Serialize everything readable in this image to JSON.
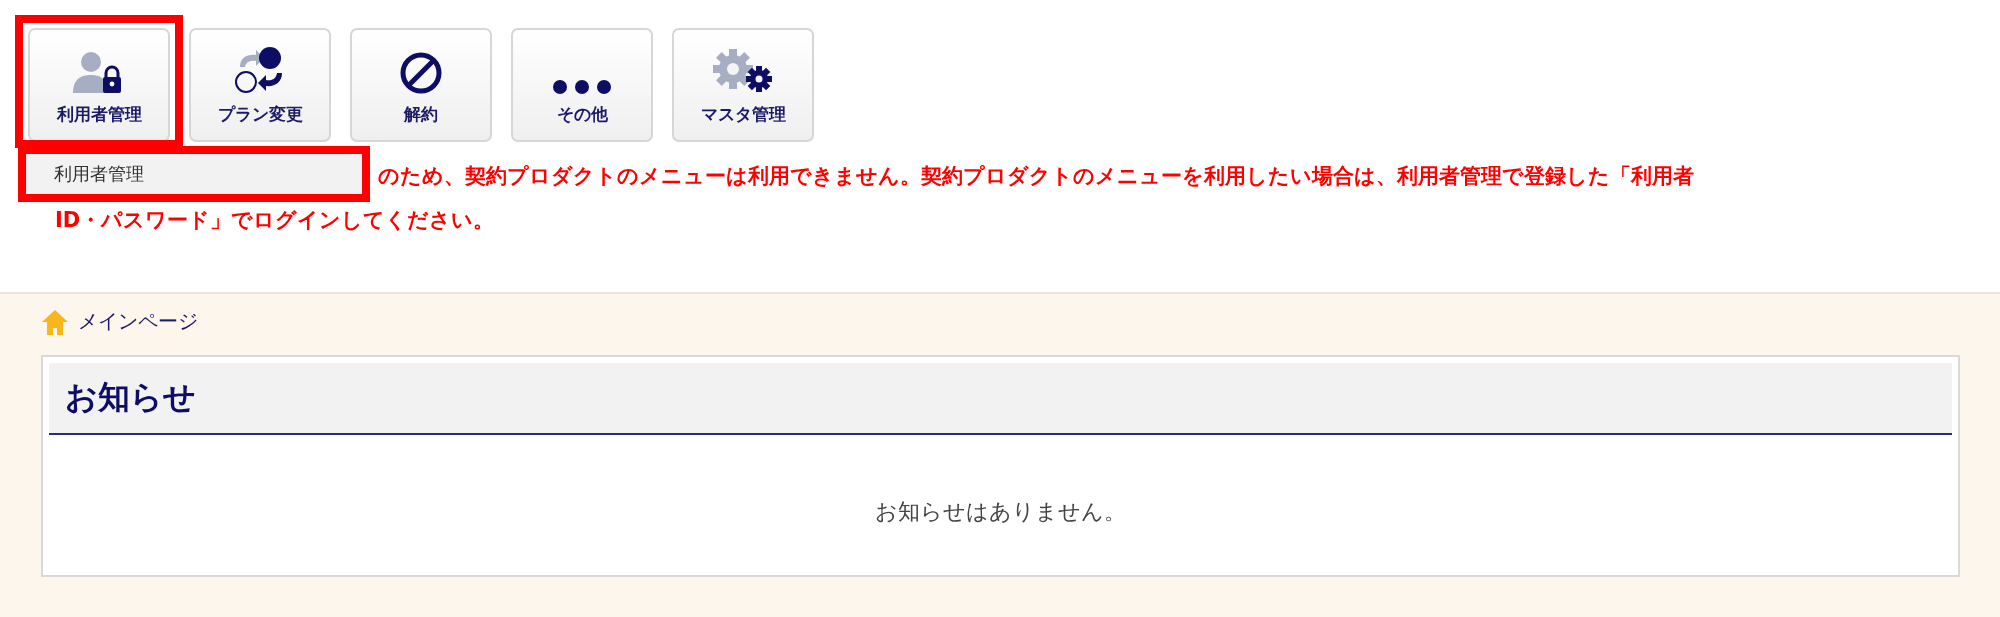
{
  "toolbar": {
    "buttons": [
      {
        "label": "利用者管理",
        "kind": "users",
        "highlighted": true
      },
      {
        "label": "プラン変更",
        "kind": "plan",
        "highlighted": false
      },
      {
        "label": "解約",
        "kind": "cancel",
        "highlighted": false
      },
      {
        "label": "その他",
        "kind": "other",
        "highlighted": false
      },
      {
        "label": "マスタ管理",
        "kind": "master",
        "highlighted": false
      }
    ]
  },
  "dropdown": {
    "highlighted": true,
    "items": [
      {
        "label": "利用者管理"
      }
    ]
  },
  "notice_message": {
    "lines": [
      "のため、契約プロダクトのメニューは利用できません。契約プロダクトのメニューを利用したい場合は、利用者管理で登録した「利用者",
      "ID・パスワード」でログインしてください。"
    ]
  },
  "breadcrumb": {
    "label": "メインページ"
  },
  "news_panel": {
    "title": "お知らせ",
    "empty_text": "お知らせはありません。"
  }
}
